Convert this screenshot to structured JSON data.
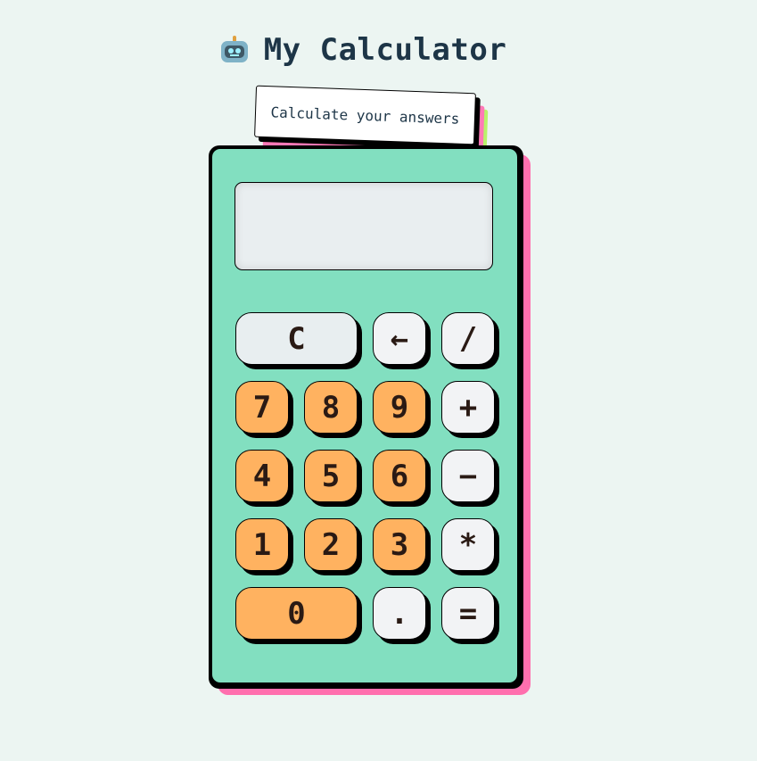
{
  "header": {
    "icon": "robot-icon",
    "title": "My Calculator"
  },
  "tag": {
    "text": "Calculate your answers"
  },
  "display": {
    "value": ""
  },
  "keys": {
    "clear": "C",
    "backspace": "←",
    "divide": "/",
    "seven": "7",
    "eight": "8",
    "nine": "9",
    "plus": "+",
    "four": "4",
    "five": "5",
    "six": "6",
    "minus": "−",
    "one": "1",
    "two": "2",
    "three": "3",
    "multiply": "*",
    "zero": "0",
    "decimal": ".",
    "equals": "="
  },
  "colors": {
    "background": "#ecf5f2",
    "calculator_body": "#82dfc0",
    "body_shadow": "#ff6fae",
    "number_keys": "#ffb260",
    "operator_keys": "#f2f3f5",
    "title_text": "#1d3547",
    "tag_accent_green": "#b9f36b"
  }
}
